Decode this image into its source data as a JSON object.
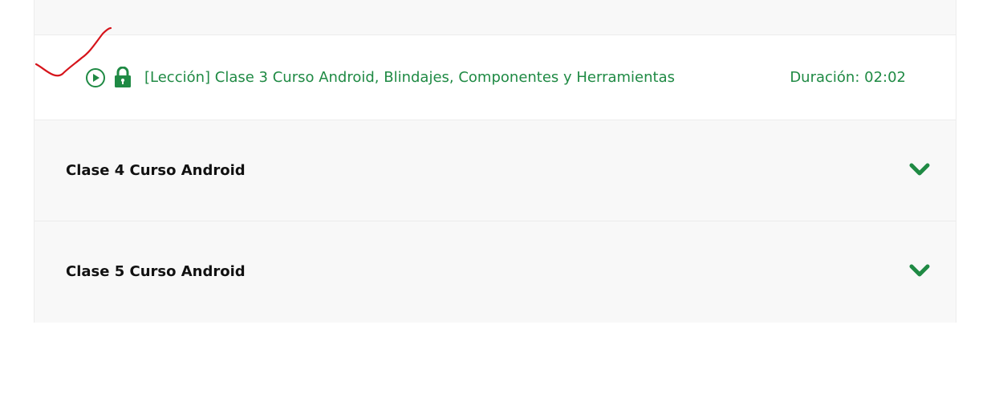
{
  "lesson": {
    "title": "[Lección] Clase 3 Curso Android, Blindajes, Componentes y Herramientas",
    "duration": "Duración: 02:02",
    "play_icon": "play-circle-icon",
    "lock_icon": "lock-icon"
  },
  "sections": [
    {
      "title": "Clase 4 Curso Android",
      "icon": "chevron-down-icon"
    },
    {
      "title": "Clase 5 Curso Android",
      "icon": "chevron-down-icon"
    }
  ],
  "colors": {
    "accent_green": "#1f8a44",
    "annotation_red": "#d6141b",
    "row_background": "#f8f8f8",
    "border": "#ececec"
  }
}
